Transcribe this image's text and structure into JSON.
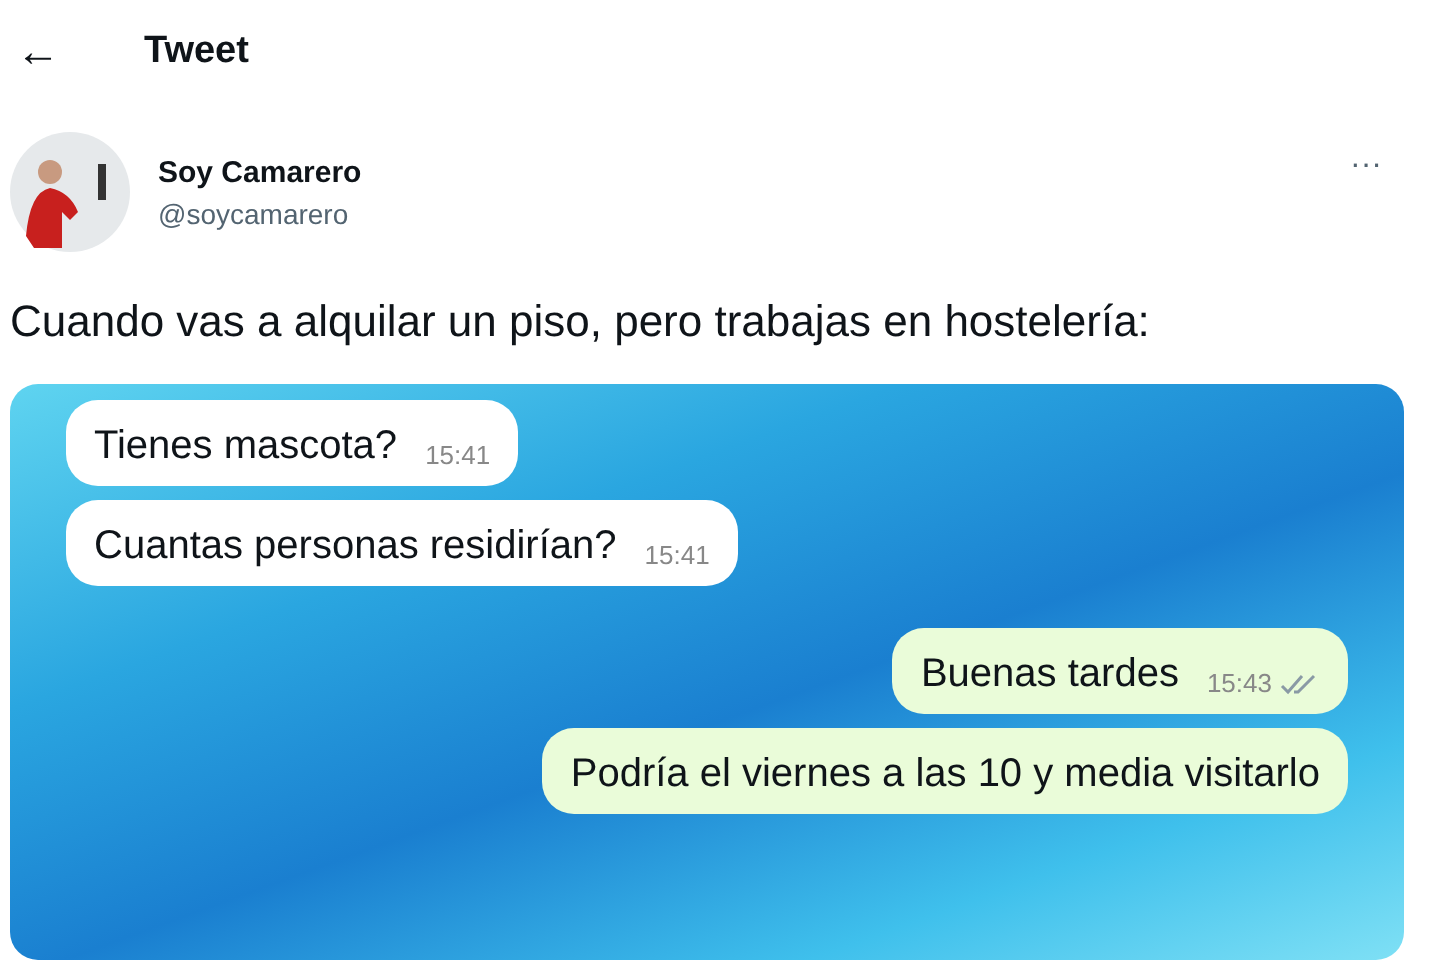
{
  "header": {
    "back": "←",
    "title": "Tweet"
  },
  "author": {
    "name": "Soy Camarero",
    "handle": "@soycamarero",
    "more": "···"
  },
  "text": "Cuando vas a alquilar un piso, pero trabajas en hostelería:",
  "messages": [
    {
      "kind": "received",
      "text": "Tienes mascota?",
      "time": "15:41"
    },
    {
      "kind": "received",
      "text": "Cuantas personas residirían?",
      "time": "15:41"
    },
    {
      "kind": "sent",
      "text": "Buenas tardes",
      "time": "15:43",
      "read": true
    },
    {
      "kind": "sent",
      "text": "Podría el  viernes a las 10 y media visitarlo",
      "read": false
    }
  ]
}
